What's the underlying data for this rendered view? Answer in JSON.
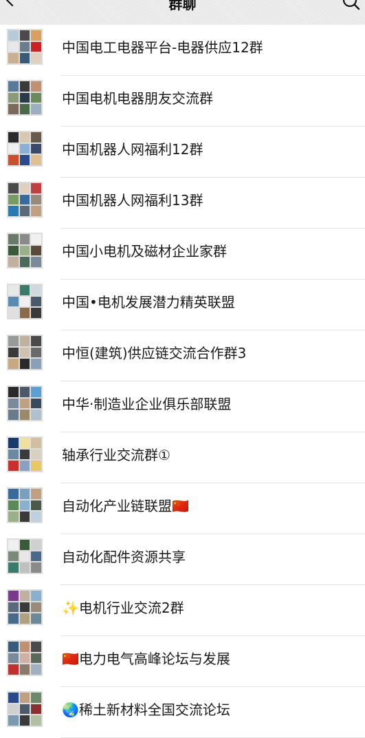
{
  "header": {
    "title": "群聊"
  },
  "groups": [
    {
      "name": "中国电工电器平台-电器供应12群",
      "colors": [
        "#b8c9d8",
        "#4a4a4a",
        "#d8a060",
        "#e8e8e8",
        "#6a7d8c",
        "#cc2222",
        "#c8b090",
        "#3a5a7a",
        "#e0d0c0"
      ]
    },
    {
      "name": "中国电机电器朋友交流群",
      "colors": [
        "#5a7a9a",
        "#3a3a3a",
        "#c09070",
        "#8a9a7a",
        "#2a3a4a",
        "#6a8a5a",
        "#7a6a5a",
        "#4a6a4a",
        "#9ab0c0"
      ]
    },
    {
      "name": "中国机器人网福利12群",
      "colors": [
        "#2a2a2a",
        "#d8c8b0",
        "#6a5a4a",
        "#f0f0f0",
        "#8ab0d8",
        "#3a4a6a",
        "#c85030",
        "#2a4a8a",
        "#e0c090"
      ]
    },
    {
      "name": "中国机器人网福利13群",
      "colors": [
        "#4a4a4a",
        "#e0d0c0",
        "#c04040",
        "#7a9a6a",
        "#3a6a9a",
        "#9a8a7a",
        "#2a7ab0",
        "#5a6a7a",
        "#c0a080"
      ]
    },
    {
      "name": "中国小电机及磁材企业家群",
      "colors": [
        "#6a7a6a",
        "#8a8a8a",
        "#f0f0f0",
        "#3a5a3a",
        "#9ab08a",
        "#5a4a3a",
        "#c0b0a0",
        "#4a6a5a",
        "#7a8a9a"
      ]
    },
    {
      "name": "中国•电机发展潜力精英联盟",
      "colors": [
        "#e8e8e8",
        "#3a7a6a",
        "#d0d8e0",
        "#5a8ab0",
        "#f0f0f0",
        "#4a5a6a",
        "#e0e0e0",
        "#8a6a4a",
        "#3a3a3a"
      ]
    },
    {
      "name": "中恒(建筑)供应链交流合作群3",
      "colors": [
        "#9a9a9a",
        "#c0b0a0",
        "#4a4a4a",
        "#3a3a3a",
        "#d0c0b0",
        "#6a6a6a",
        "#c8a880",
        "#2a2a2a",
        "#8aa0b8"
      ]
    },
    {
      "name": "中华·制造业企业俱乐部联盟",
      "colors": [
        "#2a2a2a",
        "#4a5a6a",
        "#5aa0d0",
        "#7a8a9a",
        "#c0a080",
        "#3a4a5a",
        "#6a7a8a",
        "#9a8a6a",
        "#b0c0d0"
      ]
    },
    {
      "name": "轴承行业交流群①",
      "colors": [
        "#1a3a6a",
        "#f0e0a0",
        "#d0c0a0",
        "#6a8aa0",
        "#3a3a3a",
        "#d8d0c0",
        "#c83030",
        "#8aa0c0",
        "#e8c860"
      ]
    },
    {
      "name": "自动化产业链联盟🇨🇳",
      "colors": [
        "#3a6a9a",
        "#7aa0c0",
        "#c0a080",
        "#5a8a5a",
        "#8ab0d0",
        "#4a5a4a",
        "#9ab08a",
        "#3a3a3a",
        "#c0d0e0"
      ]
    },
    {
      "name": "自动化配件资源共享",
      "colors": [
        "#f0f0f0",
        "#3a5a3a",
        "#d0d0d0",
        "#7a8a7a",
        "#e8e8e8",
        "#4a6a8a",
        "#3a7a6a",
        "#c0c0c0",
        "#8a8a8a"
      ]
    },
    {
      "name": "✨电机行业交流2群",
      "colors": [
        "#7a3a8a",
        "#c0b0a0",
        "#8ab0d0",
        "#5a6a7a",
        "#3a3a3a",
        "#9a8a7a",
        "#4a6a8a",
        "#b0a080",
        "#6a8a9a"
      ]
    },
    {
      "name": "🇨🇳电力电气高峰论坛与发展",
      "colors": [
        "#3a5a7a",
        "#c09070",
        "#4a4a4a",
        "#7a8a9a",
        "#d0b0a0",
        "#5a6a5a",
        "#c03030",
        "#8a7a6a",
        "#a0b0c0"
      ]
    },
    {
      "name": "🌏稀土新材料全国交流论坛",
      "colors": [
        "#2a4a8a",
        "#c0a080",
        "#6a8a6a",
        "#d0d0d0",
        "#4a5a6a",
        "#8a3030",
        "#7a9ab0",
        "#3a3a3a",
        "#b0c0a0"
      ]
    }
  ]
}
